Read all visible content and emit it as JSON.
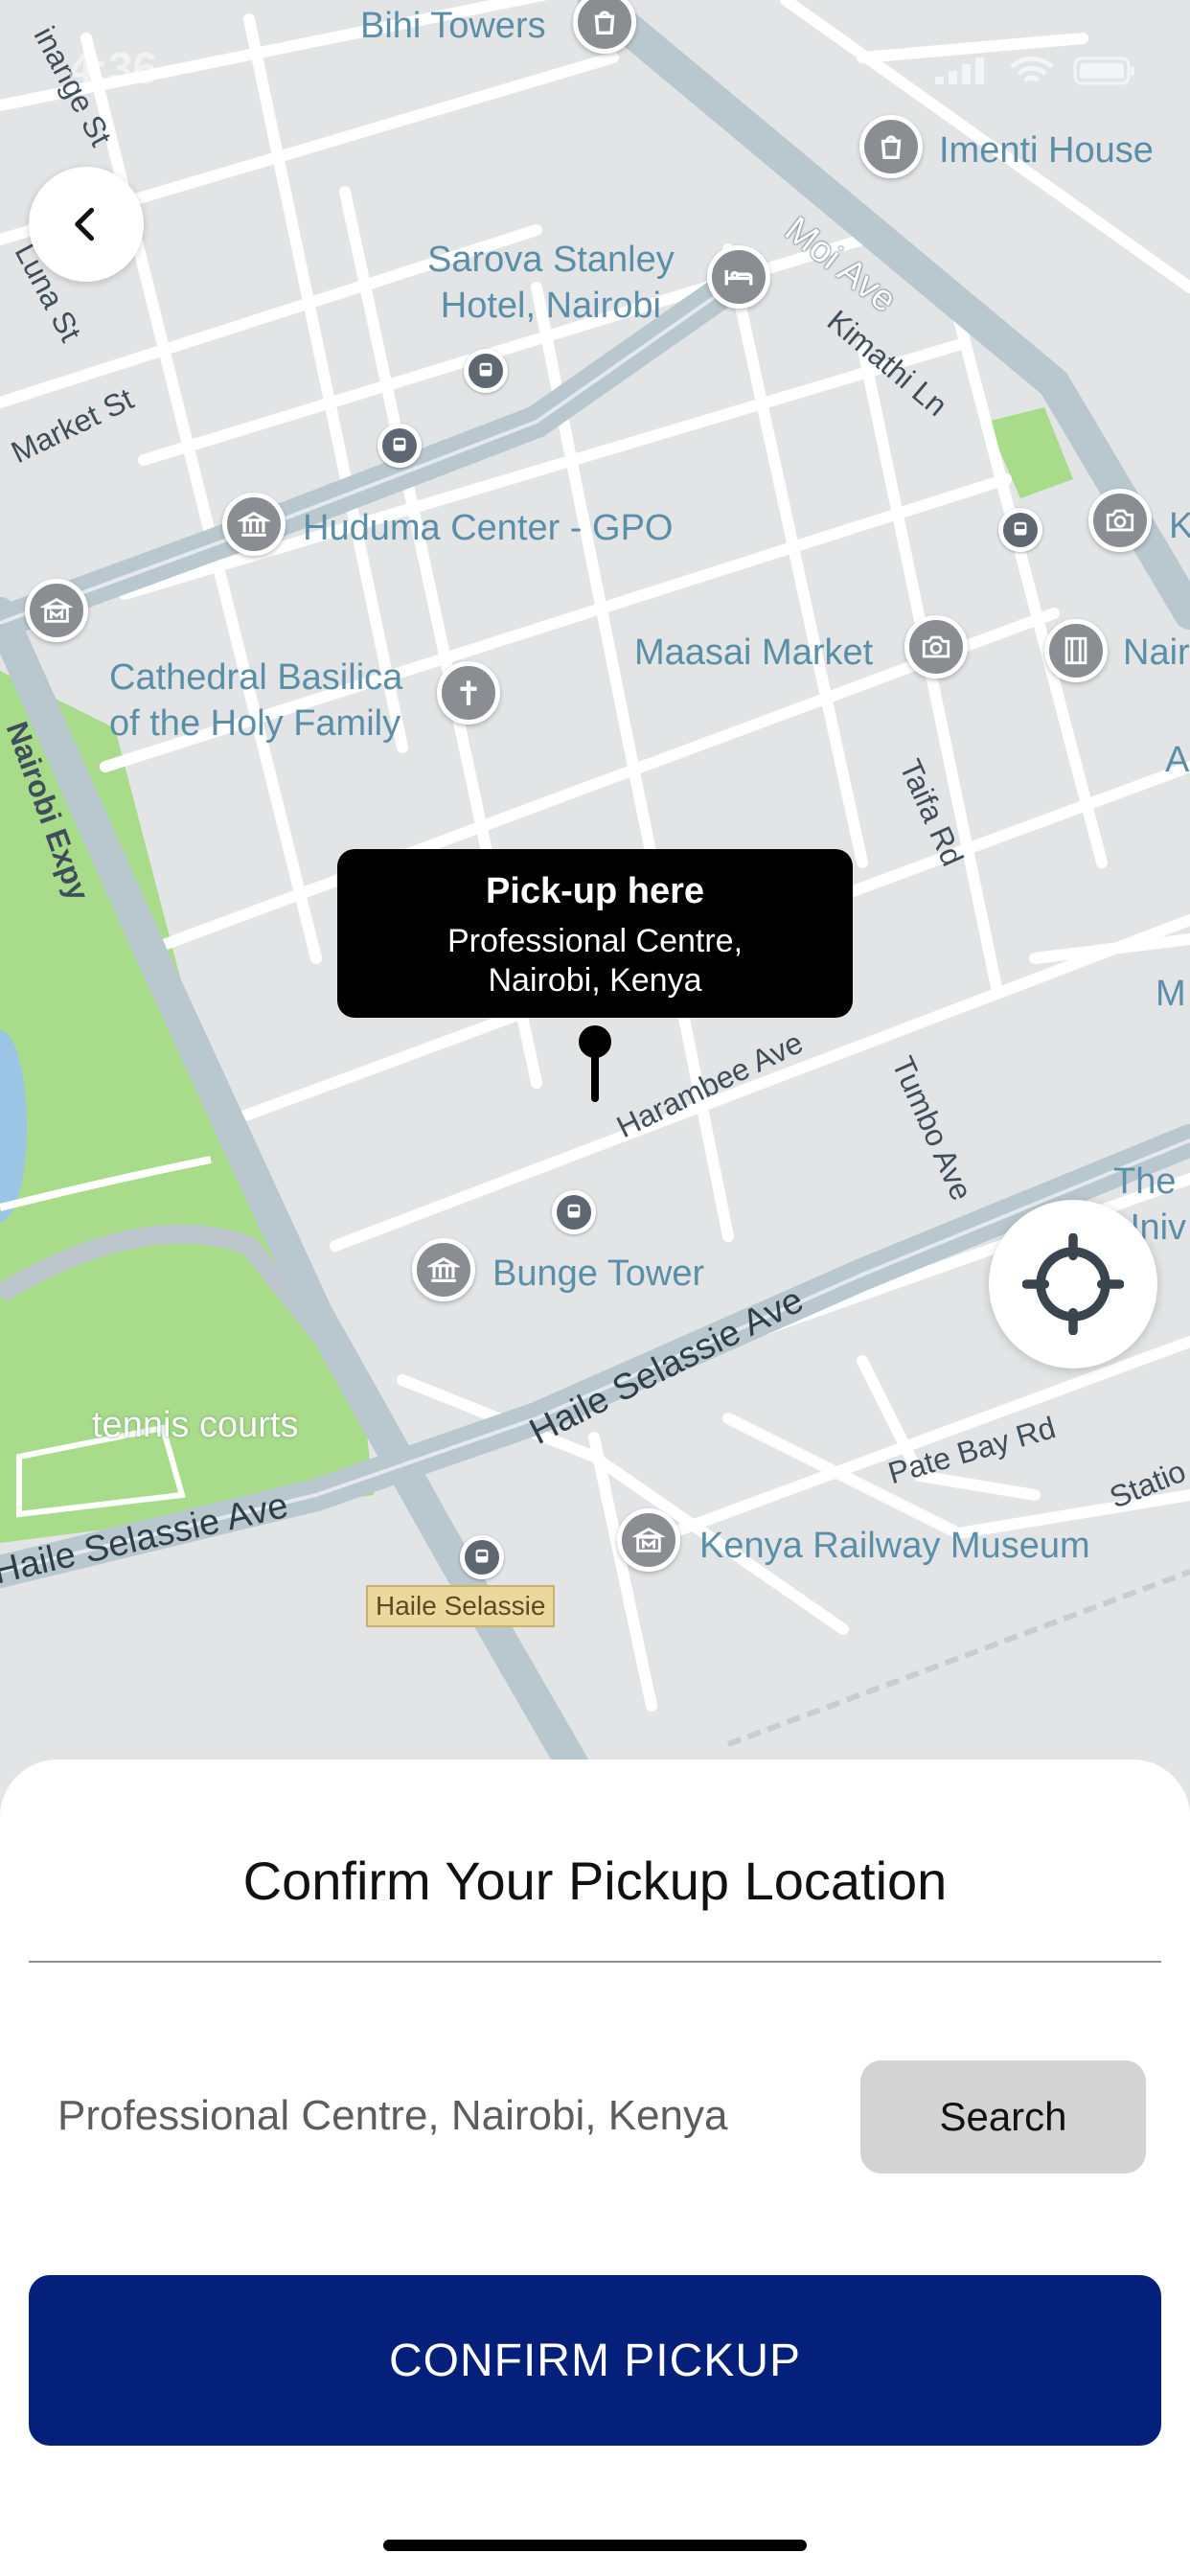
{
  "status_bar": {
    "time": "4:36"
  },
  "map": {
    "labels": [
      "Bihi Towers",
      "Imenti House",
      "Sarova Stanley\nHotel, Nairobi",
      "Huduma Center - GPO",
      "Cathedral Basilica\nof the Holy Family",
      "Maasai Market",
      "Nair",
      "Bunge Tower",
      "The\nUniv\nK",
      "tennis courts",
      "Kenya Railway Museum",
      "A",
      "M",
      "K"
    ],
    "streets": [
      "Moi Ave",
      "Kimathi Ln",
      "Market St",
      "Luna St",
      "Nairobi Expy",
      "Taifa Rd",
      "Harambee Ave",
      "Tumbo Ave",
      "Haile Selassie Ave",
      "Haile Selassie Ave",
      "Pate Bay Rd",
      "Statio",
      "inange St"
    ],
    "transit_tag": "Haile Selassie",
    "pin_callout": {
      "title": "Pick-up here",
      "address": "Professional Centre,\nNairobi, Kenya"
    }
  },
  "sheet": {
    "title": "Confirm Your Pickup Location",
    "location_value": "Professional Centre, Nairobi, Kenya",
    "search_label": "Search",
    "confirm_label": "CONFIRM PICKUP"
  },
  "colors": {
    "primary": "#04207a",
    "park": "#a8dc8a",
    "road_major": "#b9c7cf",
    "water": "#9cc4e4"
  },
  "icons": [
    "chevron-left-icon",
    "locate-crosshair-icon",
    "bus-stop-icon",
    "museum-icon",
    "hotel-icon",
    "church-icon",
    "camera-icon",
    "shopping-bag-icon",
    "bank-icon",
    "film-icon"
  ]
}
